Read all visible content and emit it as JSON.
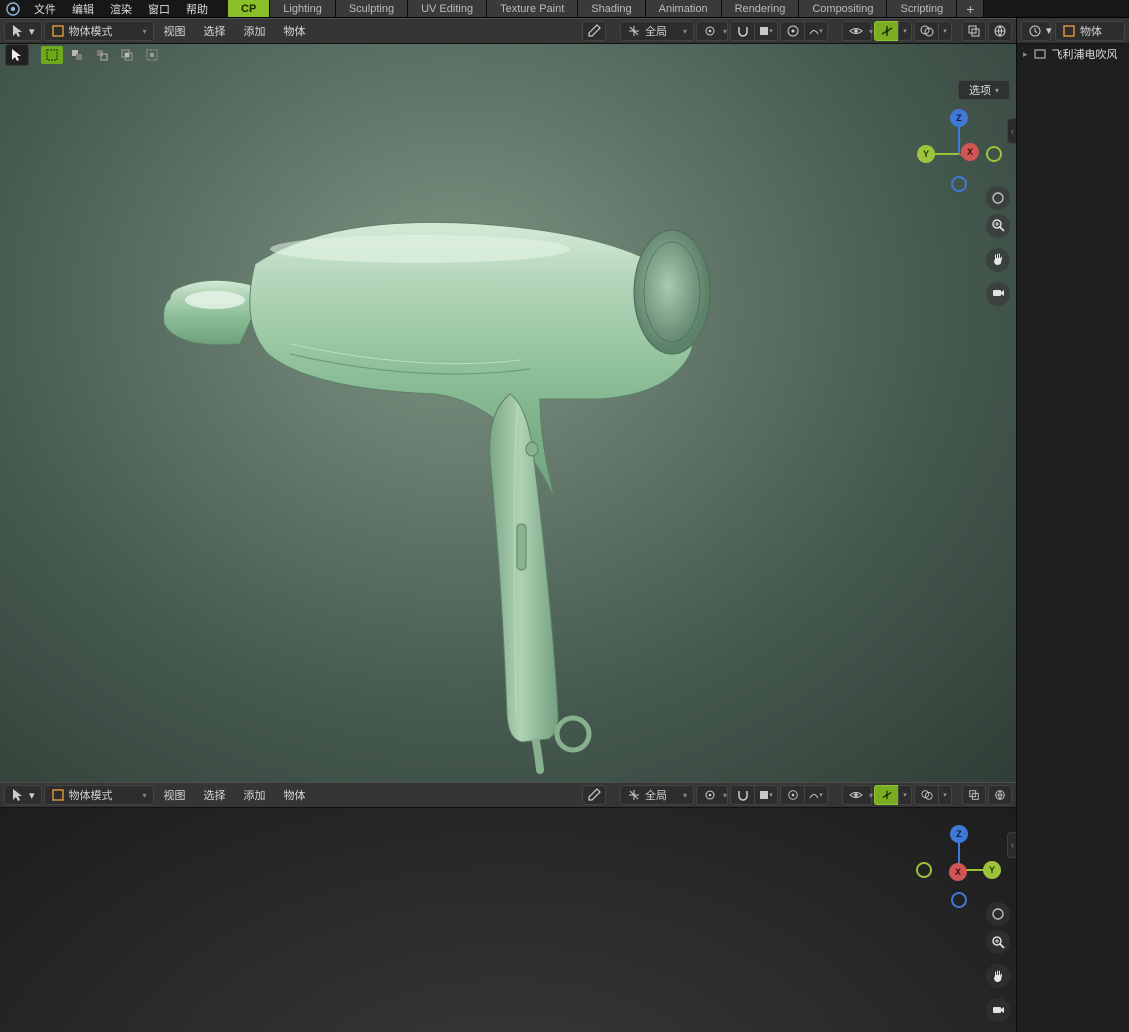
{
  "mainmenu": {
    "file": "文件",
    "edit": "编辑",
    "render": "渲染",
    "window": "窗口",
    "help": "帮助"
  },
  "tabs": [
    {
      "label": "CP",
      "active": true
    },
    {
      "label": "Lighting"
    },
    {
      "label": "Sculpting"
    },
    {
      "label": "UV Editing"
    },
    {
      "label": "Texture Paint"
    },
    {
      "label": "Shading"
    },
    {
      "label": "Animation"
    },
    {
      "label": "Rendering"
    },
    {
      "label": "Compositing"
    },
    {
      "label": "Scripting"
    }
  ],
  "tab_add_glyph": "+",
  "viewport": {
    "mode_label": "物体模式",
    "menus": {
      "view": "视图",
      "select": "选择",
      "add": "添加",
      "object": "物体"
    },
    "orient_label": "全局",
    "options_label": "选项"
  },
  "gizmo": {
    "x": "X",
    "y": "Y",
    "z": "Z"
  },
  "right": {
    "mode_label": "物体",
    "outliner_item": "飞利浦电吹风"
  },
  "side_tab_glyph": "‹"
}
